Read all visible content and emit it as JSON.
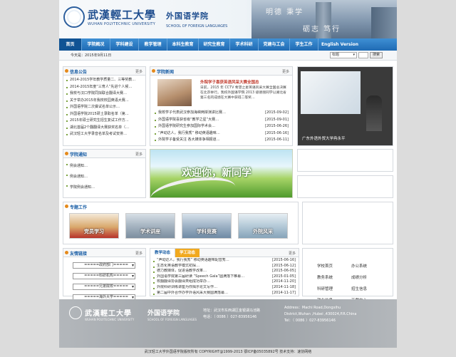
{
  "header": {
    "logo_cn": "武漢輕工大學",
    "logo_en": "WUHAN POLYTECHNIC UNIVERSITY",
    "school_cn": "外国语学院",
    "school_en": "SCHOOL OF FOREIGN LANGUAGES",
    "motto_line1": "明德 秉学",
    "motto_line2": "砺志 笃行"
  },
  "nav": {
    "items": [
      {
        "label": "首页",
        "width": 32,
        "active": true
      },
      {
        "label": "学院概况",
        "width": 40
      },
      {
        "label": "学科建设",
        "width": 40
      },
      {
        "label": "教学管理",
        "width": 40
      },
      {
        "label": "本科生教育",
        "width": 44
      },
      {
        "label": "研究生教育",
        "width": 44
      },
      {
        "label": "学术科研",
        "width": 40
      },
      {
        "label": "党建与工会",
        "width": 44
      },
      {
        "label": "学生工作",
        "width": 40
      },
      {
        "label": "English Version",
        "width": 60
      }
    ]
  },
  "toolbar": {
    "date": "今天是：2015年9月11日",
    "select_value": "标题",
    "search_label": "搜索"
  },
  "notices": {
    "title": "信息公告",
    "more": "更多",
    "items": [
      "2014-2015学年教学质量二、三等奖教…",
      "2014-2015年度“三育人”先进个人候…",
      "我校与汉口学院同拟联合翻译大赛…",
      "关于举办2015年我校校园英语大赛…",
      "外国语学院二次聋试名单公示…",
      "外国语学院2015研土录取名单（第…",
      "2015年硕士研究生招生复试工作方…",
      "湖北首届2个翻翻译大赛获奖名单（…",
      "武汉轻工大学录音名单及考试安排…"
    ]
  },
  "news": {
    "title": "学院新闻",
    "more": "更多",
    "headline": "外院学子喜获英语风采大赛全国总",
    "summary": "日前，2015 年 CCTV 希望之星英语风采大赛全国总决赛在北京举行。我校外国语学院 2013 级德丽同学以湖北省第三名的成绩在大赛中获得二等奖…",
    "items": [
      {
        "t": "我校学子代表武汉参加海峡两岸演讲比赛…",
        "d": "[2015-09-02]"
      },
      {
        "t": "外国语学院喜获省级“教学之星”大赛…",
        "d": "[2015-09-01]"
      },
      {
        "t": "外国语学院研究生参加国际学术会…",
        "d": "[2015-06-26]"
      },
      {
        "t": "“声动达人，我行我秀” 移动英语趣味…",
        "d": "[2015-06-16]"
      },
      {
        "t": "外院学子备受关注 各大媒体争相报道…",
        "d": "[2015-06-11]"
      }
    ]
  },
  "photo_caption": "广东外语外贸大学冉永平",
  "academic": {
    "title": "学院通知",
    "more": "更多",
    "items": [
      "例会通知…",
      "例会通知…",
      "学院例会通知…"
    ]
  },
  "banner_text": "欢迎你，新同学",
  "features": {
    "title": "专题工作",
    "thumbs": [
      "党员学习",
      "学术讲座",
      "学科竞赛",
      "外院风采"
    ]
  },
  "friend_links": {
    "title": "友情链接",
    "more": "更多",
    "selects": [
      "=====政府部门=====",
      "=====科研机构=====",
      "=====兄弟院校=====",
      "=====海外大学====="
    ]
  },
  "teaching": {
    "tab_active": "教学动态",
    "tab_other": "学工动态",
    "more": "更多",
    "items": [
      {
        "t": "“声动达人，我行我秀” 移动英语趣味配音秀…",
        "d": "[2015-06-16]"
      },
      {
        "t": "生态化英语教学模式初探…",
        "d": "[2015-06-12]"
      },
      {
        "t": "德力教媒体，促进语教学改革…",
        "d": "[2015-06-05]"
      },
      {
        "t": "外国语学院第三届研读 “Speech Gala”圆满落下帷幕…",
        "d": "[2015-01-05]"
      },
      {
        "t": "校翻翻译协会翻译类组成功举办…",
        "d": "[2014-11-20]"
      },
      {
        "t": "外院科研训练讲座为你揭示论文写作…",
        "d": "[2014-11-18]"
      },
      {
        "t": "第二届中外合作办学外语风采大赛圆满落幕…",
        "d": "[2014-11-17]"
      }
    ]
  },
  "quick_links": [
    "学校首页",
    "办公系统",
    "教务系统",
    "成绩分析",
    "科研管理",
    "招生信息",
    "就业信息",
    "下载中心"
  ],
  "footer": {
    "logo_cn": "武漢輕工大學",
    "logo_en": "WUHAN POLYTECHNIC UNIVERSITY",
    "school_cn": "外国语学院",
    "school_en": "SCHOOL OF FOREIGN LANGUAGES",
    "addr_cn": "地址：武汉市东西湖区金银湖马池路",
    "tel_cn": "电话：（ 0086 ）027-83956146",
    "addr_en1": "Address：Machi Road,Dongxihu",
    "addr_en2": "District,Wuhan ,Hubei ,430024,P.R.China",
    "tel_en": "Tel：（ 0086 ）027-83956146",
    "copyright": "武汉轻工大学外国语学院版权所有 COPYRIGHT@1999-2013 鄂ICP备05035892号 技术支持：速协网络"
  }
}
